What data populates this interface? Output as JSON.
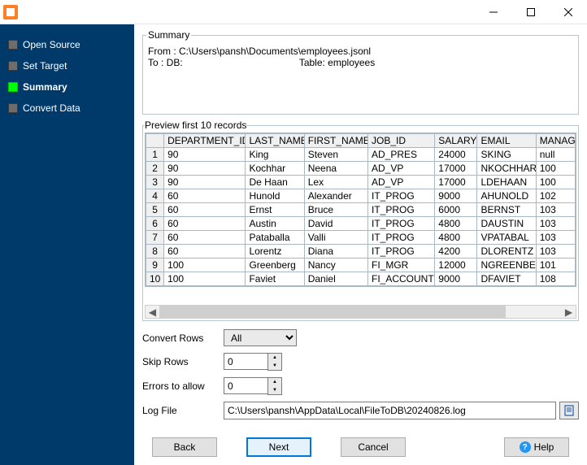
{
  "wizard": {
    "steps": [
      {
        "label": "Open Source",
        "active": false
      },
      {
        "label": "Set Target",
        "active": false
      },
      {
        "label": "Summary",
        "active": true
      },
      {
        "label": "Convert Data",
        "active": false
      }
    ]
  },
  "summary": {
    "legend": "Summary",
    "from_line": "From : C:\\Users\\pansh\\Documents\\employees.jsonl",
    "to_line": "To : DB:                                           Table: employees"
  },
  "preview": {
    "legend": "Preview first 10 records",
    "columns": [
      "DEPARTMENT_ID",
      "LAST_NAME",
      "FIRST_NAME",
      "JOB_ID",
      "SALARY",
      "EMAIL",
      "MANAG"
    ],
    "rows": [
      [
        "90",
        "King",
        "Steven",
        "AD_PRES",
        "24000",
        "SKING",
        "null"
      ],
      [
        "90",
        "Kochhar",
        "Neena",
        "AD_VP",
        "17000",
        "NKOCHHAR",
        "100"
      ],
      [
        "90",
        "De Haan",
        "Lex",
        "AD_VP",
        "17000",
        "LDEHAAN",
        "100"
      ],
      [
        "60",
        "Hunold",
        "Alexander",
        "IT_PROG",
        "9000",
        "AHUNOLD",
        "102"
      ],
      [
        "60",
        "Ernst",
        "Bruce",
        "IT_PROG",
        "6000",
        "BERNST",
        "103"
      ],
      [
        "60",
        "Austin",
        "David",
        "IT_PROG",
        "4800",
        "DAUSTIN",
        "103"
      ],
      [
        "60",
        "Pataballa",
        "Valli",
        "IT_PROG",
        "4800",
        "VPATABAL",
        "103"
      ],
      [
        "60",
        "Lorentz",
        "Diana",
        "IT_PROG",
        "4200",
        "DLORENTZ",
        "103"
      ],
      [
        "100",
        "Greenberg",
        "Nancy",
        "FI_MGR",
        "12000",
        "NGREENBE",
        "101"
      ],
      [
        "100",
        "Faviet",
        "Daniel",
        "FI_ACCOUNT",
        "9000",
        "DFAVIET",
        "108"
      ]
    ]
  },
  "options": {
    "convert_rows_label": "Convert Rows",
    "convert_rows_value": "All",
    "skip_rows_label": "Skip Rows",
    "skip_rows_value": "0",
    "errors_label": "Errors to allow",
    "errors_value": "0",
    "logfile_label": "Log File",
    "logfile_value": "C:\\Users\\pansh\\AppData\\Local\\FileToDB\\20240826.log"
  },
  "buttons": {
    "back": "Back",
    "next": "Next",
    "cancel": "Cancel",
    "help": "Help"
  }
}
